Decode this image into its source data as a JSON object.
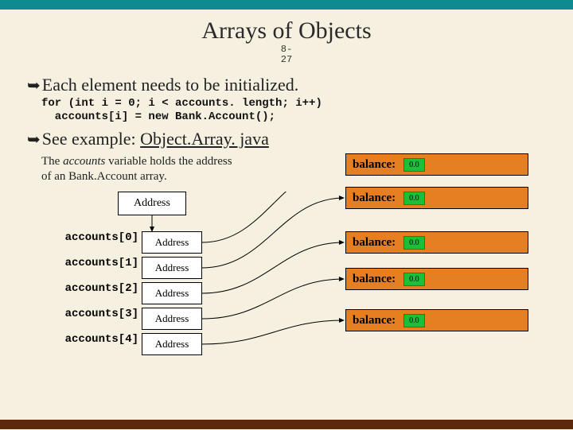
{
  "title": "Arrays of Objects",
  "page_num_top": "8-",
  "page_num_bot": "27",
  "bullet1": "Each element needs to be initialized.",
  "code_line1": "for (int i = 0; i < accounts. length; i++)",
  "code_line2": "  accounts[i] = new Bank.Account();",
  "bullet2_pre": "See example: ",
  "bullet2_link": "Object.Array. java",
  "note_html1": "The ",
  "note_em": "accounts",
  "note_html2": " variable holds the address",
  "note_html3": "of an Bank.Account array.",
  "address_top": "Address",
  "rows": [
    {
      "label": "accounts[0]",
      "cell": "Address"
    },
    {
      "label": "accounts[1]",
      "cell": "Address"
    },
    {
      "label": "accounts[2]",
      "cell": "Address"
    },
    {
      "label": "accounts[3]",
      "cell": "Address"
    },
    {
      "label": "accounts[4]",
      "cell": "Address"
    }
  ],
  "obj_label": "balance:",
  "obj_value": "0.0"
}
